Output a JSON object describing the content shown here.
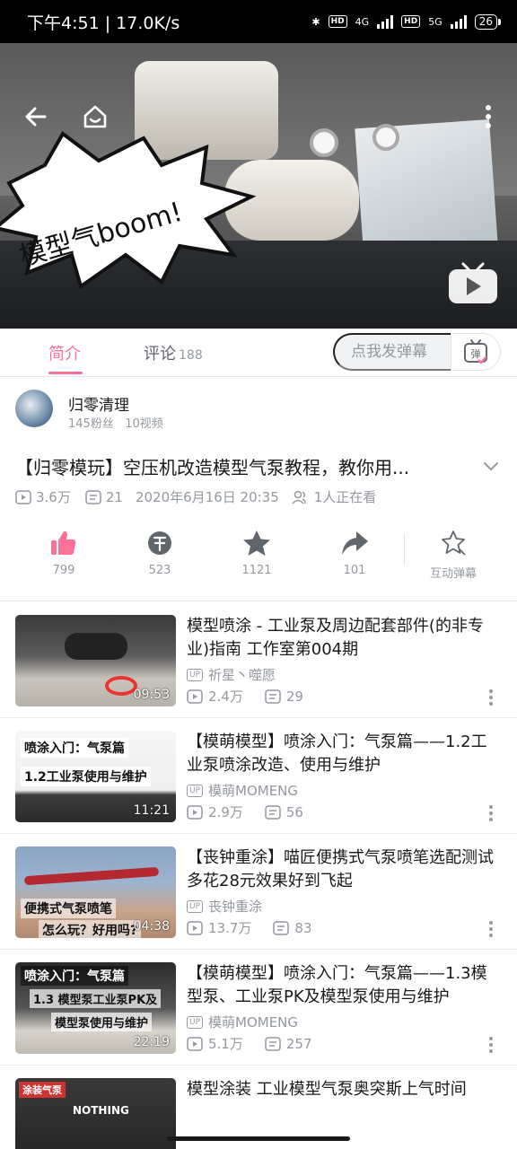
{
  "status_bar": {
    "time": "下午4:51 | 17.0K/s",
    "network_1": "4G",
    "network_2": "5G",
    "battery": "26"
  },
  "video": {
    "overlay_title": "模型气boom!"
  },
  "tabs": [
    {
      "label": "简介"
    },
    {
      "label": "评论",
      "count": "188"
    }
  ],
  "danmaku": {
    "placeholder": "点我发弹幕",
    "button_label": "弹"
  },
  "uploader": {
    "name": "归零清理",
    "fans": "145粉丝",
    "videos": "10视频"
  },
  "video_info": {
    "title": "【归零模玩】空压机改造模型气泵教程，教你用...",
    "plays": "3.6万",
    "danmaku_count": "21",
    "date": "2020年6月16日 20:35",
    "watching": "1人正在看"
  },
  "actions": [
    {
      "icon": "thumbs-up-icon",
      "label": "799"
    },
    {
      "icon": "coin-icon",
      "label": "523"
    },
    {
      "icon": "star-icon",
      "label": "1121"
    },
    {
      "icon": "share-icon",
      "label": "101"
    },
    {
      "icon": "interactive-danmaku-icon",
      "label": "互动弹幕"
    }
  ],
  "recommendations": [
    {
      "title": "模型喷涂 - 工业泵及周边配套部件(的非专业)指南 工作室第004期",
      "owner": "祈星丶噬愿",
      "plays": "2.4万",
      "danmaku": "29",
      "duration": "09:53"
    },
    {
      "title": "【模萌模型】喷涂入门：气泵篇——1.2工业泵喷涂改造、使用与维护",
      "owner": "模萌MOMENG",
      "plays": "2.9万",
      "danmaku": "56",
      "duration": "11:21",
      "thumb_text": [
        "喷涂入门：气泵篇",
        "1.2工业泵使用与维护"
      ]
    },
    {
      "title": "【丧钟重涂】喵匠便携式气泵喷笔选配测试多花28元效果好到飞起",
      "owner": "丧钟重涂",
      "plays": "13.7万",
      "danmaku": "83",
      "duration": "04:38",
      "thumb_text": [
        "便携式气泵喷笔",
        "怎么玩？好用吗?"
      ]
    },
    {
      "title": "【模萌模型】喷涂入门：气泵篇——1.3模型泵、工业泵PK及模型泵使用与维护",
      "owner": "模萌MOMENG",
      "plays": "5.1万",
      "danmaku": "257",
      "duration": "22:19",
      "thumb_text": [
        "喷涂入门：气泵篇",
        "1.3 模型泵工业泵PK及",
        "模型泵使用与维护"
      ]
    },
    {
      "title": "模型涂装  工业模型气泵奥突斯上气时间",
      "owner": "",
      "plays": "",
      "danmaku": "",
      "duration": "",
      "thumb_text": [
        "涂装气泵",
        "NOTHING"
      ]
    }
  ],
  "colors": {
    "accent": "#fb7299",
    "icon_gray": "#61666d",
    "meta_gray": "#9499a0"
  }
}
